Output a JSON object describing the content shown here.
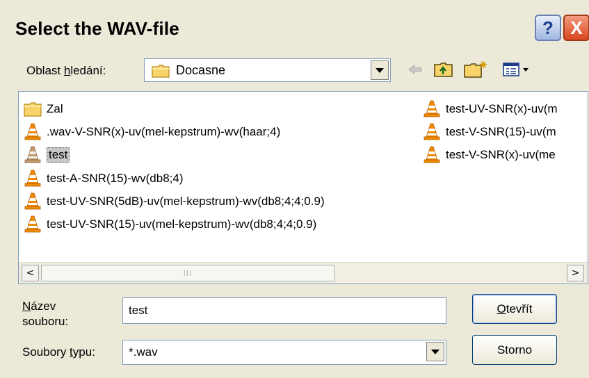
{
  "window": {
    "title": "Select the WAV-file",
    "help_label": "?",
    "close_label": "X"
  },
  "lookin": {
    "label_pre": "Oblast ",
    "label_u": "h",
    "label_post": "ledání:",
    "value": "Docasne"
  },
  "files": [
    {
      "name": "Zal",
      "type": "folder"
    },
    {
      "name": ".wav-V-SNR(x)-uv(mel-kepstrum)-wv(haar;4)",
      "type": "vlc"
    },
    {
      "name": "test",
      "type": "vlc",
      "selected": true
    },
    {
      "name": "test-A-SNR(15)-wv(db8;4)",
      "type": "vlc"
    },
    {
      "name": "test-UV-SNR(5dB)-uv(mel-kepstrum)-wv(db8;4;4;0.9)",
      "type": "vlc"
    },
    {
      "name": "test-UV-SNR(15)-uv(mel-kepstrum)-wv(db8;4;4;0.9)",
      "type": "vlc"
    },
    {
      "name": "test-UV-SNR(x)-uv(m",
      "type": "vlc"
    },
    {
      "name": "test-V-SNR(15)-uv(m",
      "type": "vlc"
    },
    {
      "name": "test-V-SNR(x)-uv(me",
      "type": "vlc"
    }
  ],
  "filename": {
    "label_u": "N",
    "label_l1_rest": "ázev",
    "label_l2": "souboru:",
    "value": "test"
  },
  "filetype": {
    "label_pre": "Soubory ",
    "label_u": "t",
    "label_post": "ypu:",
    "value": "*.wav"
  },
  "buttons": {
    "open_u": "O",
    "open_rest": "tevřít",
    "cancel": "Storno"
  },
  "scroll": {
    "left": "<",
    "right": ">",
    "grip": "III"
  },
  "colors": {
    "dialog_bg": "#ece9d8",
    "selection": "#c7c7c7",
    "vlc_orange": "#f08a00"
  },
  "icons": {
    "back": "back-arrow-icon",
    "up": "up-folder-icon",
    "new": "new-folder-icon",
    "view": "view-menu-icon"
  }
}
